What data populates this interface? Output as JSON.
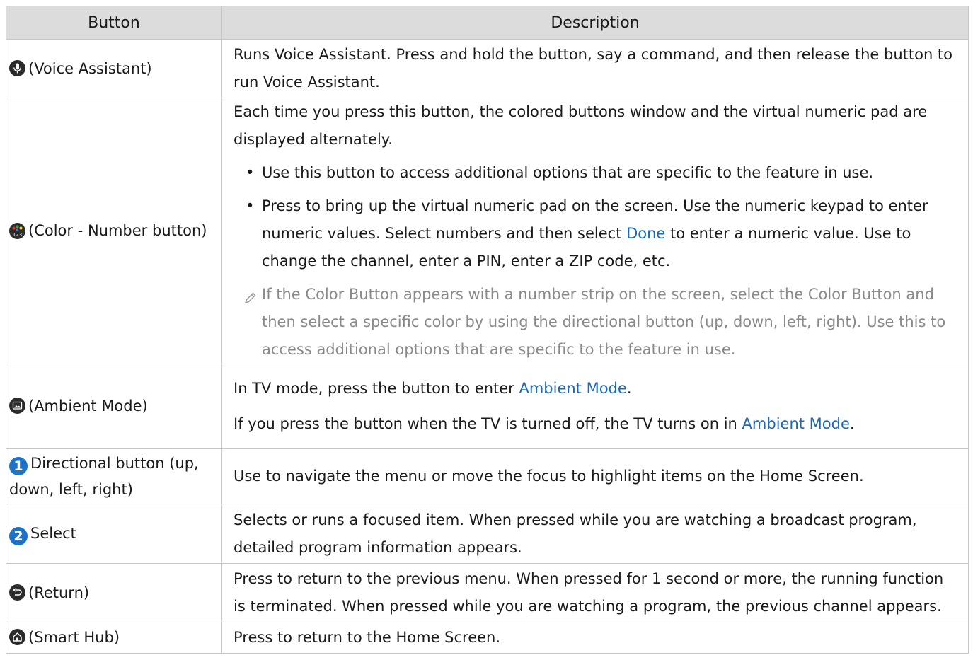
{
  "headers": {
    "button": "Button",
    "description": "Description"
  },
  "rows": {
    "voice": {
      "button": "(Voice Assistant)",
      "desc": "Runs Voice Assistant. Press and hold the button, say a command, and then release the button to run Voice Assistant."
    },
    "color": {
      "button": "(Color - Number button)",
      "intro": "Each time you press this button, the colored buttons window and the virtual numeric pad are displayed alternately.",
      "bullet1": "Use this button to access additional options that are specific to the feature in use.",
      "bullet2_a": "Press to bring up the virtual numeric pad on the screen. Use the numeric keypad to enter numeric values. Select numbers and then select ",
      "bullet2_link": "Done",
      "bullet2_b": " to enter a numeric value. Use to change the channel, enter a PIN, enter a ZIP code, etc.",
      "note": "If the Color Button appears with a number strip on the screen, select the Color Button and then select a specific color by using the directional button (up, down, left, right). Use this to access additional options that are specific to the feature in use."
    },
    "ambient": {
      "button": "(Ambient Mode)",
      "line1_a": "In TV mode, press the button to enter ",
      "line1_link": "Ambient Mode",
      "line1_b": ".",
      "line2_a": "If you press the button when the TV is turned off, the TV turns on in ",
      "line2_link": "Ambient Mode",
      "line2_b": "."
    },
    "directional": {
      "number": "1",
      "button": "Directional button (up, down, left, right)",
      "desc": "Use to navigate the menu or move the focus to highlight items on the Home Screen."
    },
    "select": {
      "number": "2",
      "button": "Select",
      "desc": "Selects or runs a focused item. When pressed while you are watching a broadcast program, detailed program information appears."
    },
    "return": {
      "button": "(Return)",
      "desc": "Press to return to the previous menu. When pressed for 1 second or more, the running function is terminated. When pressed while you are watching a program, the previous channel appears."
    },
    "smarthub": {
      "button": "(Smart Hub)",
      "desc": "Press to return to the Home Screen."
    }
  },
  "colors": {
    "header_bg": "#dcdcdc",
    "link": "#1b69b8",
    "number_badge": "#1e73c8",
    "note_text": "#8a8a8a"
  }
}
